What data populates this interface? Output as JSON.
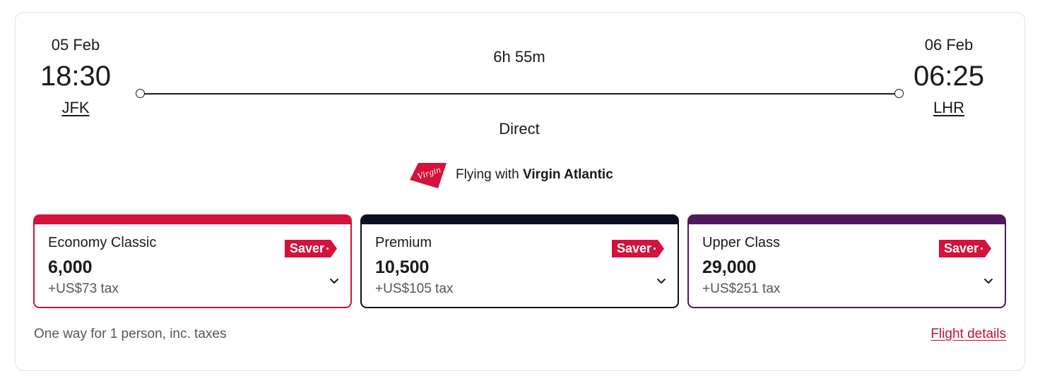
{
  "departure": {
    "date": "05 Feb",
    "time": "18:30",
    "airport": "JFK"
  },
  "arrival": {
    "date": "06 Feb",
    "time": "06:25",
    "airport": "LHR"
  },
  "duration": "6h 55m",
  "stops": "Direct",
  "airline": {
    "prefix": "Flying with",
    "name": "Virgin Atlantic",
    "logo_text": "Virgin",
    "logo_icon": "virgin-tail-logo-icon",
    "logo_color": "#d4123c"
  },
  "fares": [
    {
      "cabin": "Economy Classic",
      "points": "6,000",
      "tax": "+US$73 tax",
      "badge": "Saver",
      "accent": "#d4123c"
    },
    {
      "cabin": "Premium",
      "points": "10,500",
      "tax": "+US$105 tax",
      "badge": "Saver",
      "accent": "#0c0f1d"
    },
    {
      "cabin": "Upper Class",
      "points": "29,000",
      "tax": "+US$251 tax",
      "badge": "Saver",
      "accent": "#4e1a5c"
    }
  ],
  "footer": {
    "note": "One way for 1 person, inc. taxes",
    "details_link": "Flight details"
  },
  "colors": {
    "brand_red": "#c8102e",
    "muted_text": "#555560",
    "border": "#e3e3e6"
  }
}
